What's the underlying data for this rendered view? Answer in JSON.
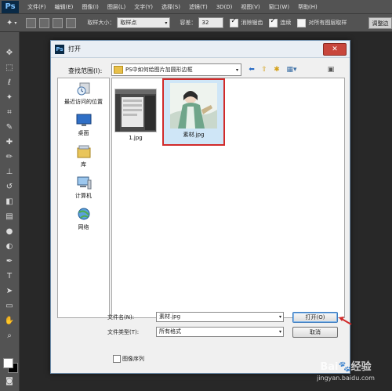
{
  "app": {
    "logo": "Ps"
  },
  "menu": [
    "文件(F)",
    "编辑(E)",
    "图像(I)",
    "图层(L)",
    "文字(Y)",
    "选择(S)",
    "滤镜(T)",
    "3D(D)",
    "视图(V)",
    "窗口(W)",
    "帮助(H)"
  ],
  "options_bar": {
    "sample_size_label": "取样大小：",
    "sample_size_value": "取样点",
    "tolerance_label": "容差：",
    "tolerance_value": "32",
    "antialias_label": "消除锯齿",
    "antialias_checked": true,
    "contiguous_label": "连续",
    "contiguous_checked": true,
    "all_layers_label": "对所有图层取样",
    "all_layers_checked": false,
    "adjust_edge_label": "调整边"
  },
  "dialog": {
    "title": "打开",
    "look_in_label": "查找范围(I):",
    "look_in_value": "PS中如何给图片加圆形边框",
    "places": [
      {
        "label": "最近访问的位置",
        "icon": "recent-places-icon"
      },
      {
        "label": "桌面",
        "icon": "desktop-icon"
      },
      {
        "label": "库",
        "icon": "library-icon"
      },
      {
        "label": "计算机",
        "icon": "computer-icon"
      },
      {
        "label": "网络",
        "icon": "network-icon"
      }
    ],
    "files": [
      {
        "name": "1.jpg",
        "selected": false
      },
      {
        "name": "素材.jpg",
        "selected": true
      }
    ],
    "filename_label": "文件名(N):",
    "filename_value": "素材.jpg",
    "filetype_label": "文件类型(T):",
    "filetype_value": "所有格式",
    "open_button": "打开(O)",
    "cancel_button": "取消",
    "image_sequence_label": "图像序列",
    "image_sequence_checked": false
  },
  "watermark": {
    "logo": "Bai🐾经验",
    "url": "jingyan.baidu.com"
  },
  "colors": {
    "ps_chrome": "#535353",
    "workspace": "#282828",
    "dialog_bg": "#f0f0f0",
    "highlight_red": "#d12a2a",
    "close_red": "#c8463c"
  }
}
